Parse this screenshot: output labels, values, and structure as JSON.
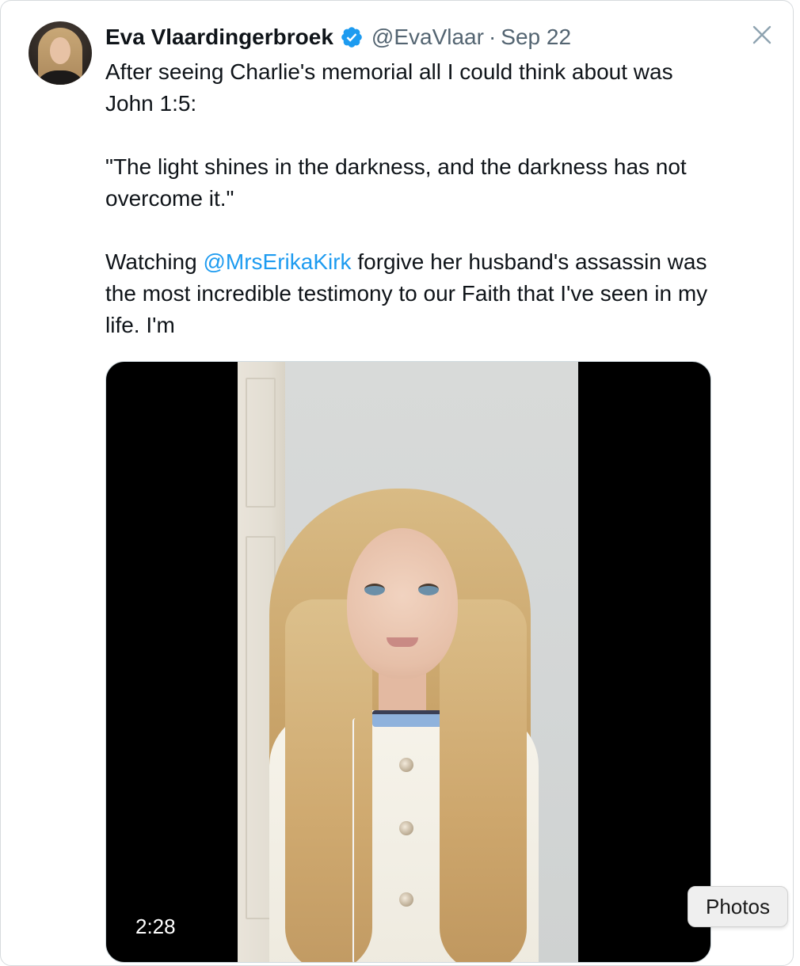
{
  "tweet": {
    "display_name": "Eva Vlaardingerbroek",
    "handle": "@EvaVlaar",
    "separator": "·",
    "date": "Sep 22",
    "text_line1": "After seeing Charlie's memorial all I could think about was John 1:5:",
    "quote": "\"The light shines in the darkness, and the darkness has not overcome it.\"",
    "para3_before_mention": "Watching ",
    "mention": "@MrsErikaKirk",
    "para3_after_mention": " forgive her husband's assassin was the most incredible testimony to our Faith that I've seen in my life. I'm"
  },
  "media": {
    "duration": "2:28"
  },
  "tooltip": {
    "label": "Photos"
  },
  "icons": {
    "verified": "verified-badge-icon",
    "close": "close-icon"
  },
  "colors": {
    "link": "#1d9bf0",
    "verified": "#1d9bf0",
    "secondary_text": "#536471"
  }
}
